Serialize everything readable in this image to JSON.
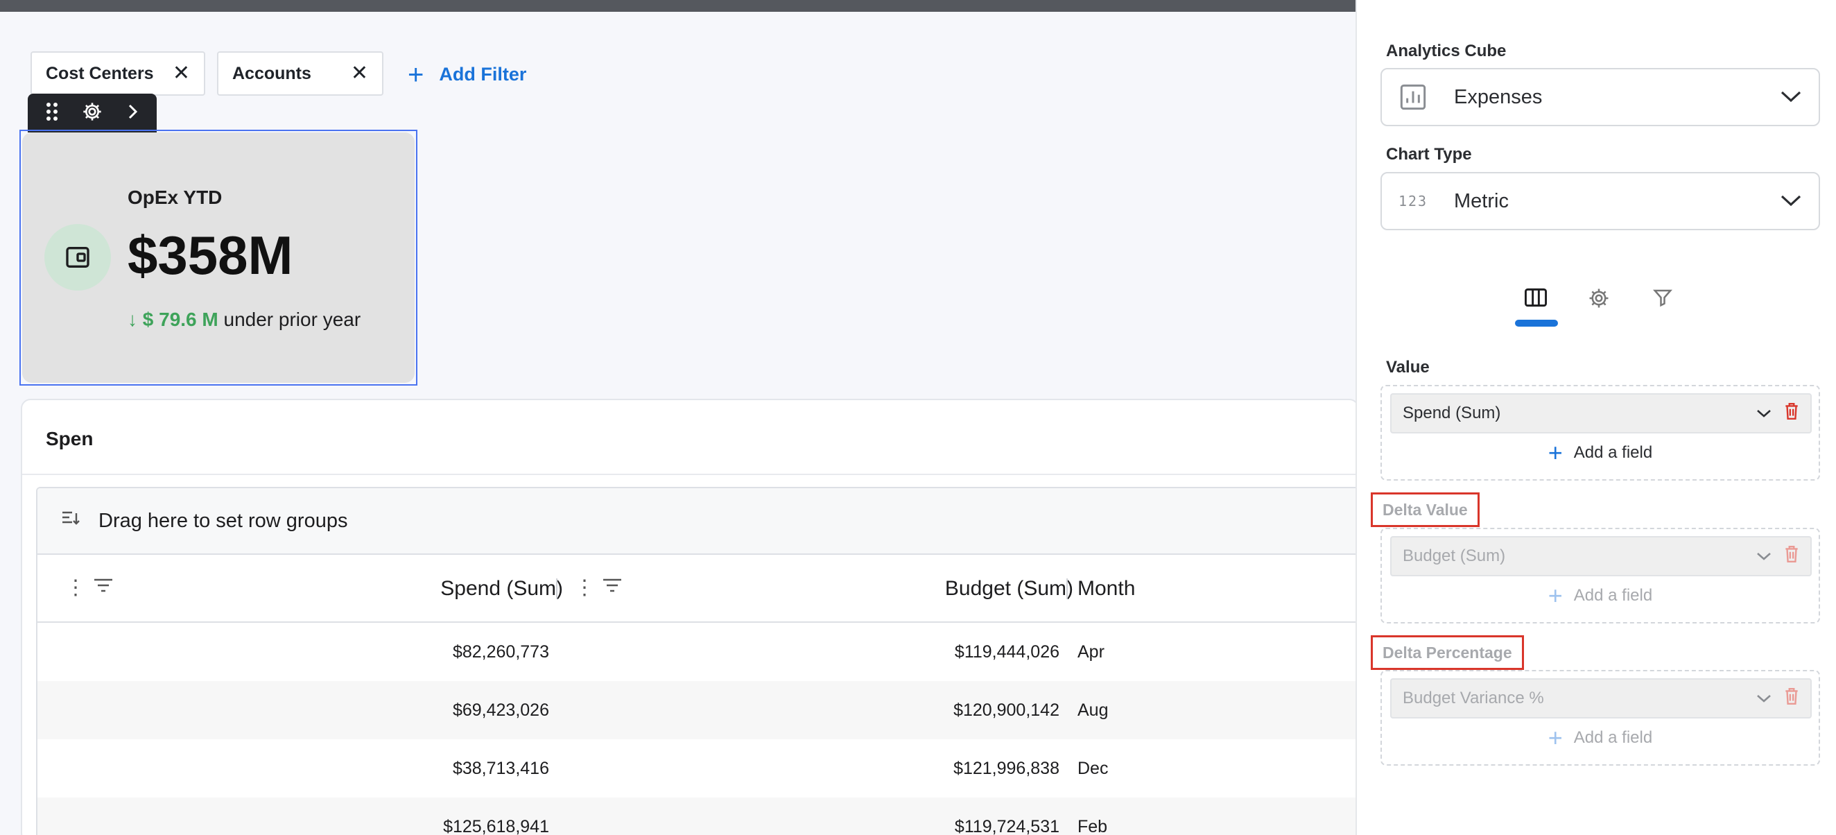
{
  "filters": {
    "chips": [
      {
        "label": "Cost Centers"
      },
      {
        "label": "Accounts"
      }
    ],
    "add_filter_label": "Add Filter"
  },
  "metric_card": {
    "title": "OpEx YTD",
    "value": "$358M",
    "delta_value": "$ 79.6 M",
    "delta_text": "under prior year",
    "delta_color": "#3ea35a"
  },
  "spend_panel": {
    "title": "Spen",
    "row_group_hint": "Drag here to set row groups",
    "columns": [
      "Spend (Sum)",
      "Budget (Sum)",
      "Month"
    ],
    "rows": [
      {
        "spend": "$82,260,773",
        "budget": "$119,444,026",
        "month": "Apr"
      },
      {
        "spend": "$69,423,026",
        "budget": "$120,900,142",
        "month": "Aug"
      },
      {
        "spend": "$38,713,416",
        "budget": "$121,996,838",
        "month": "Dec"
      },
      {
        "spend": "$125,618,941",
        "budget": "$119,724,531",
        "month": "Feb"
      }
    ]
  },
  "sidebar": {
    "analytics_cube_label": "Analytics Cube",
    "analytics_cube_value": "Expenses",
    "chart_type_label": "Chart Type",
    "chart_type_icon_text": "123",
    "chart_type_value": "Metric",
    "value_label": "Value",
    "value_field": "Spend (Sum)",
    "add_field_label": "Add a field",
    "delta_value_label": "Delta Value",
    "delta_value_field": "Budget (Sum)",
    "delta_percentage_label": "Delta Percentage",
    "delta_percentage_field": "Budget Variance %",
    "accent_color": "#1a73d9",
    "highlight_color": "#d9362b"
  }
}
